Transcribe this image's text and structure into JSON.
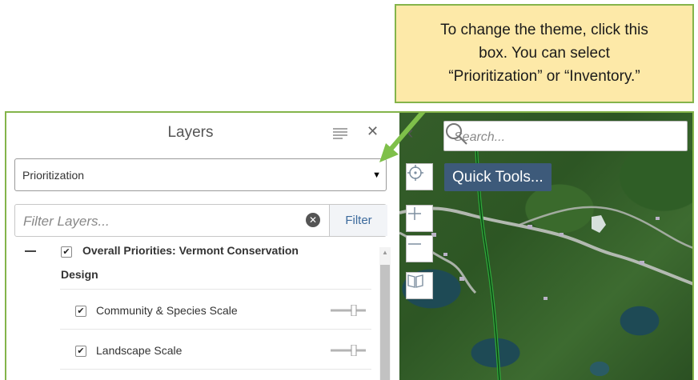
{
  "callout": {
    "line1": "To change the theme, click this",
    "line2": "box. You can select",
    "line3": "“Prioritization” or “Inventory.”"
  },
  "panel": {
    "title": "Layers",
    "theme_select": {
      "value": "Prioritization"
    },
    "filter": {
      "placeholder": "Filter Layers...",
      "button_label": "Filter"
    },
    "layers": {
      "group": {
        "label_line1": "Overall Priorities: Vermont Conservation",
        "label_line2": "Design",
        "checked": true
      },
      "items": [
        {
          "label": "Community & Species Scale",
          "checked": true
        },
        {
          "label": "Landscape Scale",
          "checked": true
        }
      ]
    }
  },
  "map": {
    "search_placeholder": "Search...",
    "quick_tools_label": "Quick Tools..."
  },
  "colors": {
    "callout_bg": "#fde9a8",
    "frame_green": "#84b44a",
    "quick_tools_bg": "#3d5a7a",
    "filter_text": "#3c6a9c"
  }
}
